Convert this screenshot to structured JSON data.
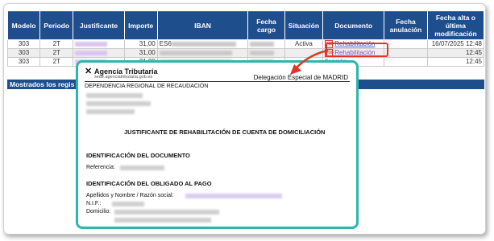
{
  "table": {
    "headers": [
      "Modelo",
      "Periodo",
      "Justificante",
      "Importe",
      "IBAN",
      "Fecha cargo",
      "Situación",
      "Documento",
      "Fecha anulación",
      "Fecha alta o última modificación"
    ],
    "rows": [
      {
        "modelo": "303",
        "periodo": "2T",
        "importe": "31,00",
        "iban": "ES6",
        "situacion": "Activa",
        "documento": "Rehabilitación",
        "fecha_alta": "16/07/2025 12:48"
      },
      {
        "modelo": "303",
        "periodo": "2T",
        "importe": "31,00",
        "iban": "",
        "situacion": "",
        "documento": "Rehabilitación",
        "fecha_alta": "12:45"
      },
      {
        "modelo": "303",
        "periodo": "2T",
        "importe": "31,00",
        "iban": "",
        "situacion": "",
        "documento": "ficación",
        "fecha_alta": "12:45"
      }
    ],
    "footer": "Mostrados los regis"
  },
  "popup": {
    "brand": "Agencia Tributaria",
    "brand_sub": "sede.agenciatributaria.gob.es",
    "delegation": "Delegación Especial de MADRID",
    "department": "DEPENDENCIA REGIONAL DE RECAUDACIÓN",
    "title": "JUSTIFICANTE DE REHABILITACIÓN DE CUENTA DE DOMICILIACIÓN",
    "sec1": "IDENTIFICACIÓN DEL DOCUMENTO",
    "ref_label": "Referencia:",
    "sec2": "IDENTIFICACIÓN DEL OBLIGADO AL PAGO",
    "name_label": "Apellidos y Nombre / Razón social:",
    "nif_label": "N.I.F.:",
    "dom_label": "Domicilio:"
  },
  "colors": {
    "header_bg": "#1f4e8c",
    "highlight": "#e63327",
    "popup_border": "#2fb5ad"
  }
}
